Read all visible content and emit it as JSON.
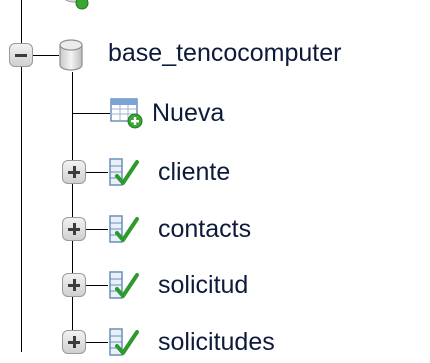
{
  "tree": {
    "database": {
      "name": "base_tencocomputer",
      "expanded": true,
      "icon": "database-icon",
      "toggle_icon": "collapse-minus-icon"
    },
    "new_item": {
      "label": "Nueva",
      "icon": "new-table-icon"
    },
    "tables": [
      {
        "name": "cliente",
        "icon": "table-icon",
        "toggle_icon": "expand-plus-icon"
      },
      {
        "name": "contacts",
        "icon": "table-icon",
        "toggle_icon": "expand-plus-icon"
      },
      {
        "name": "solicitud",
        "icon": "table-icon",
        "toggle_icon": "expand-plus-icon"
      },
      {
        "name": "solicitudes",
        "icon": "table-icon",
        "toggle_icon": "expand-plus-icon"
      }
    ]
  },
  "colors": {
    "text": "#0d1a3a",
    "tree_line": "#000000",
    "toggle_box": "#d0d0d0",
    "new_badge": "#3aa535",
    "table_check": "#2e9a2e"
  }
}
